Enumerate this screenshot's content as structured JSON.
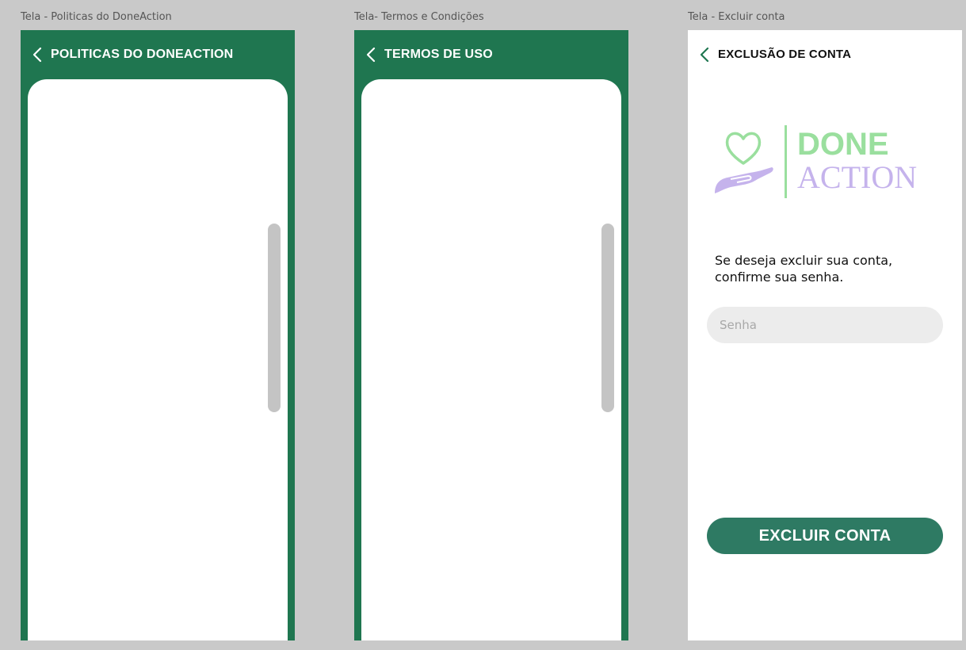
{
  "screens": [
    {
      "label": "Tela - Politicas do DoneAction",
      "title": "POLITICAS DO DONEACTION"
    },
    {
      "label": "Tela- Termos e Condições",
      "title": "TERMOS DE USO"
    },
    {
      "label": "Tela - Excluir conta",
      "title": "EXCLUSÃO DE CONTA",
      "logo": {
        "line1": "DONE",
        "line2": "ACTION"
      },
      "message": "Se deseja excluir sua conta, confirme sua senha.",
      "password_placeholder": "Senha",
      "button_label": "EXCLUIR CONTA"
    }
  ],
  "colors": {
    "header_green": "#1f7650",
    "button_green": "#2e7a63",
    "logo_green": "#9adf9e",
    "logo_purple": "#c5b3ec"
  },
  "icons": [
    "chevron-left-icon",
    "heart-hand-icon"
  ]
}
